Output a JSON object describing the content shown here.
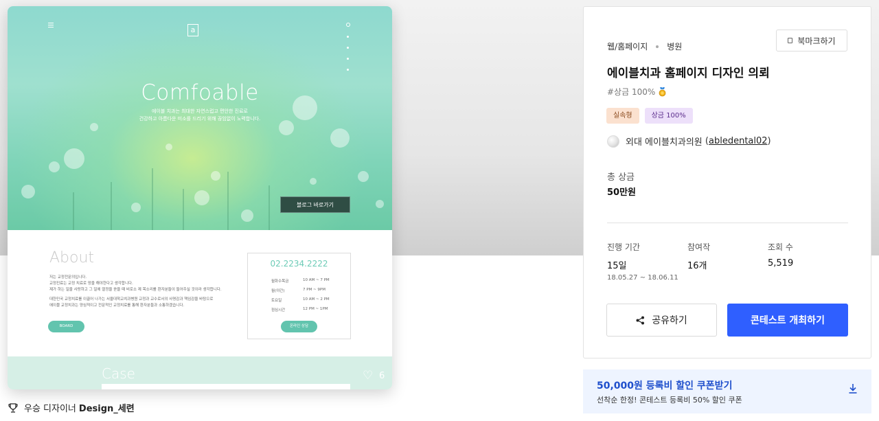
{
  "preview": {
    "hero_title": "Comfoable",
    "hero_sub_line1": "에이블 치과는 최대한 자연스럽고 편안한 진료로",
    "hero_sub_line2": "건강하고 아름다운 미소를 드리기 위해 끊임없이 노력합니다.",
    "blog_button": "블로그 바로가기",
    "about_title": "About",
    "about_text": [
      "저는 교정전문의입니다.",
      "교정진료는 교정 치료로 망을 해야한다고 생각합니다.",
      "제가 하는 일을 사랑하고 그 일에 열정을 쏟을 때 비로소 제 목소리를 환자분들이 들어주실 것이라 생각합니다.",
      "",
      "대한민국 교정치료를 이끌어 나가는 서울대학교치과병원 교정과 교수로서의 사명감과 책임감을 바탕으로",
      "에이블 교정치과는 양심적이고 전문적인 교정치료를 통해 환자분들과 소통하겠습니다."
    ],
    "board_button": "BOARD",
    "phone": "02.2234.2222",
    "hours": [
      {
        "day": "월화수목금",
        "time": "10 AM ~ 7 PM"
      },
      {
        "day": "월(야간)",
        "time": "7 PM ~ 9PM"
      },
      {
        "day": "토요일",
        "time": "10 AM ~ 2 PM"
      },
      {
        "day": "점심시간",
        "time": "12 PM ~ 1PM"
      }
    ],
    "consult_button": "온라인 상담",
    "case_title": "Case",
    "likes": "6"
  },
  "designer": {
    "label": "우승 디자이너",
    "name": "Design_세련"
  },
  "panel": {
    "category1": "웹/홈페이지",
    "category2": "병원",
    "bookmark": "북마크하기",
    "title": "에이블치과 홈페이지 디자인 의뢰",
    "tagline": "#상금 100%",
    "badge1": "실속형",
    "badge2": "상금 100%",
    "client_name": "외대 에이블치과의원",
    "client_id": "abledental02",
    "prize_label": "총 상금",
    "prize_value": "50만원",
    "stat1_label": "진행 기간",
    "stat1_value": "15일",
    "stat1_dates": "18.05.27 ~ 18.06.11",
    "stat2_label": "참여작",
    "stat2_value": "16개",
    "stat3_label": "조회 수",
    "stat3_value": "5,519",
    "share_button": "공유하기",
    "open_button": "콘테스트 개최하기"
  },
  "coupon": {
    "title": "50,000원 등록비 할인 쿠폰받기",
    "sub": "선착순 한정! 콘테스트 등록비 50% 할인 쿠폰"
  },
  "colors": {
    "primary": "#2f5fff",
    "coupon_bg": "#eef4ff",
    "coupon_text": "#1f4fcc",
    "mint": "#62c4ae"
  },
  "icons": [
    "menu-icon",
    "trophy-icon",
    "bookmark-icon",
    "medal-icon",
    "share-icon",
    "heart-icon",
    "download-icon"
  ]
}
